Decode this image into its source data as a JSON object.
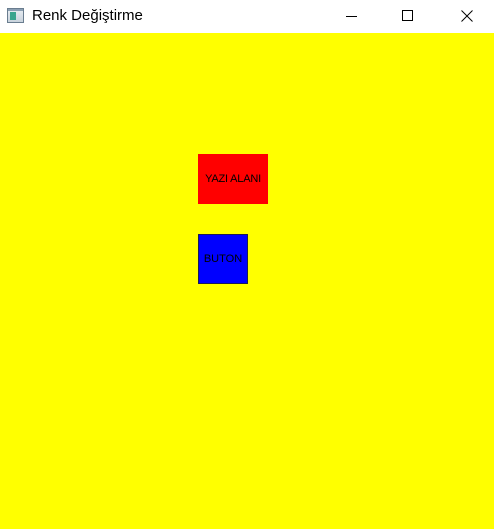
{
  "window": {
    "title": "Renk Değiştirme",
    "app_icon": "window-app-icon",
    "controls": {
      "minimize_icon": "minimize-icon",
      "maximize_icon": "maximize-icon",
      "close_icon": "close-icon"
    }
  },
  "client": {
    "background_color": "#ffff00",
    "label": {
      "text": "YAZI ALANI",
      "background_color": "#ff0000"
    },
    "button": {
      "text": "BUTON",
      "background_color": "#0000ff"
    }
  }
}
